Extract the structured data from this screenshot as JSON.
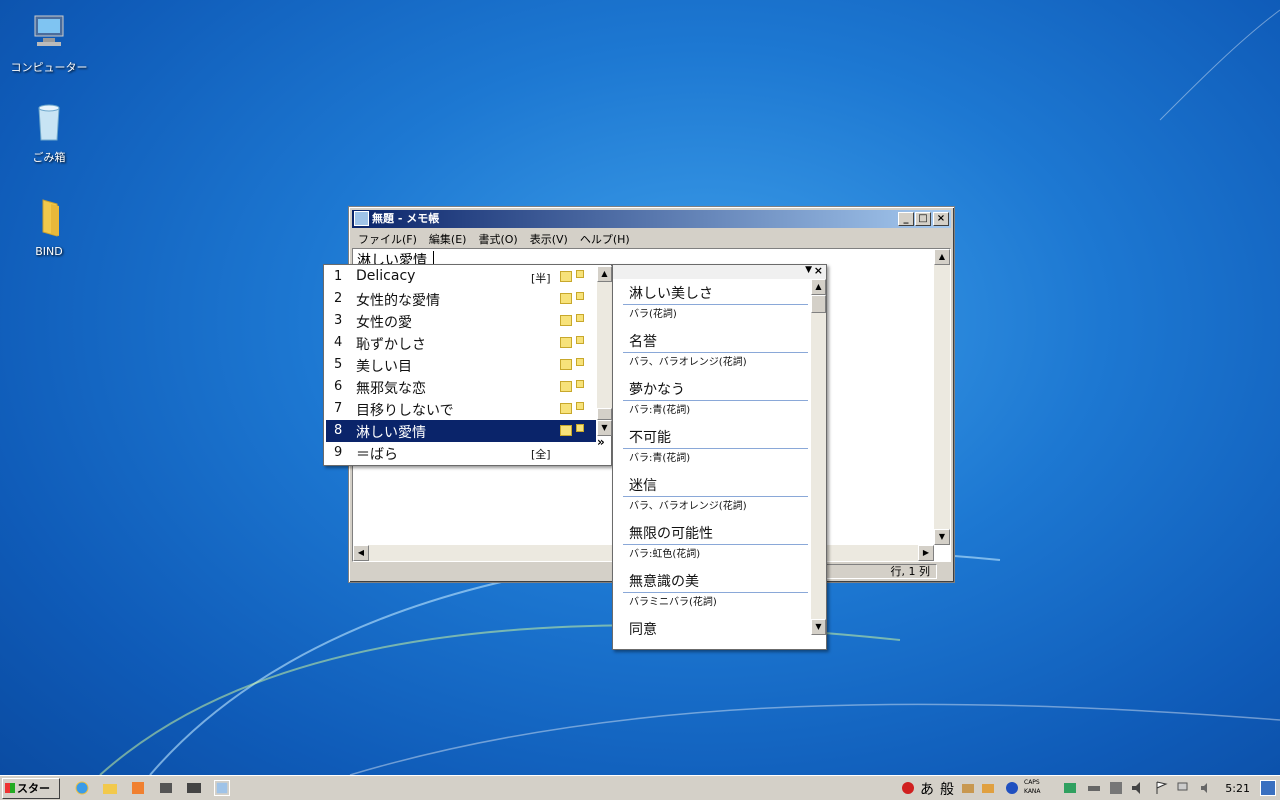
{
  "desktop": {
    "icons": [
      {
        "label": "コンピューター"
      },
      {
        "label": "ごみ箱"
      },
      {
        "label": "BIND"
      }
    ]
  },
  "notepad": {
    "title": "無題 - メモ帳",
    "menu": [
      "ファイル(F)",
      "編集(E)",
      "書式(O)",
      "表示(V)",
      "ヘルプ(H)"
    ],
    "text": "淋しい愛情",
    "status": "行, 1 列"
  },
  "candidates": {
    "items": [
      {
        "num": "1",
        "text": "Delicacy",
        "tag": "[半]"
      },
      {
        "num": "2",
        "text": "女性的な愛情",
        "tag": ""
      },
      {
        "num": "3",
        "text": "女性の愛",
        "tag": ""
      },
      {
        "num": "4",
        "text": "恥ずかしさ",
        "tag": ""
      },
      {
        "num": "5",
        "text": "美しい目",
        "tag": ""
      },
      {
        "num": "6",
        "text": "無邪気な恋",
        "tag": ""
      },
      {
        "num": "7",
        "text": "目移りしないで",
        "tag": ""
      },
      {
        "num": "8",
        "text": "淋しい愛情",
        "tag": ""
      },
      {
        "num": "9",
        "text": "＝ばら",
        "tag": "[全]"
      }
    ],
    "selected_index": 7,
    "more": "»"
  },
  "annotations": {
    "items": [
      {
        "word": "淋しい美しさ",
        "desc": "バラ(花詞)"
      },
      {
        "word": "名誉",
        "desc": "バラ、バラオレンジ(花詞)"
      },
      {
        "word": "夢かなう",
        "desc": "バラ:青(花詞)"
      },
      {
        "word": "不可能",
        "desc": "バラ:青(花詞)"
      },
      {
        "word": "迷信",
        "desc": "バラ、バラオレンジ(花詞)"
      },
      {
        "word": "無限の可能性",
        "desc": "バラ:虹色(花詞)"
      },
      {
        "word": "無意識の美",
        "desc": "バラミニバラ(花詞)"
      },
      {
        "word": "同意",
        "desc": ""
      }
    ]
  },
  "taskbar": {
    "start_label": "スタート",
    "ime_mode": "あ",
    "ime_kanji": "般",
    "caps": "CAPS",
    "kana": "KANA",
    "clock": "5:21"
  },
  "colors": {
    "selection": "#0a246a",
    "title_start": "#0a246a",
    "title_end": "#a6caf0"
  }
}
